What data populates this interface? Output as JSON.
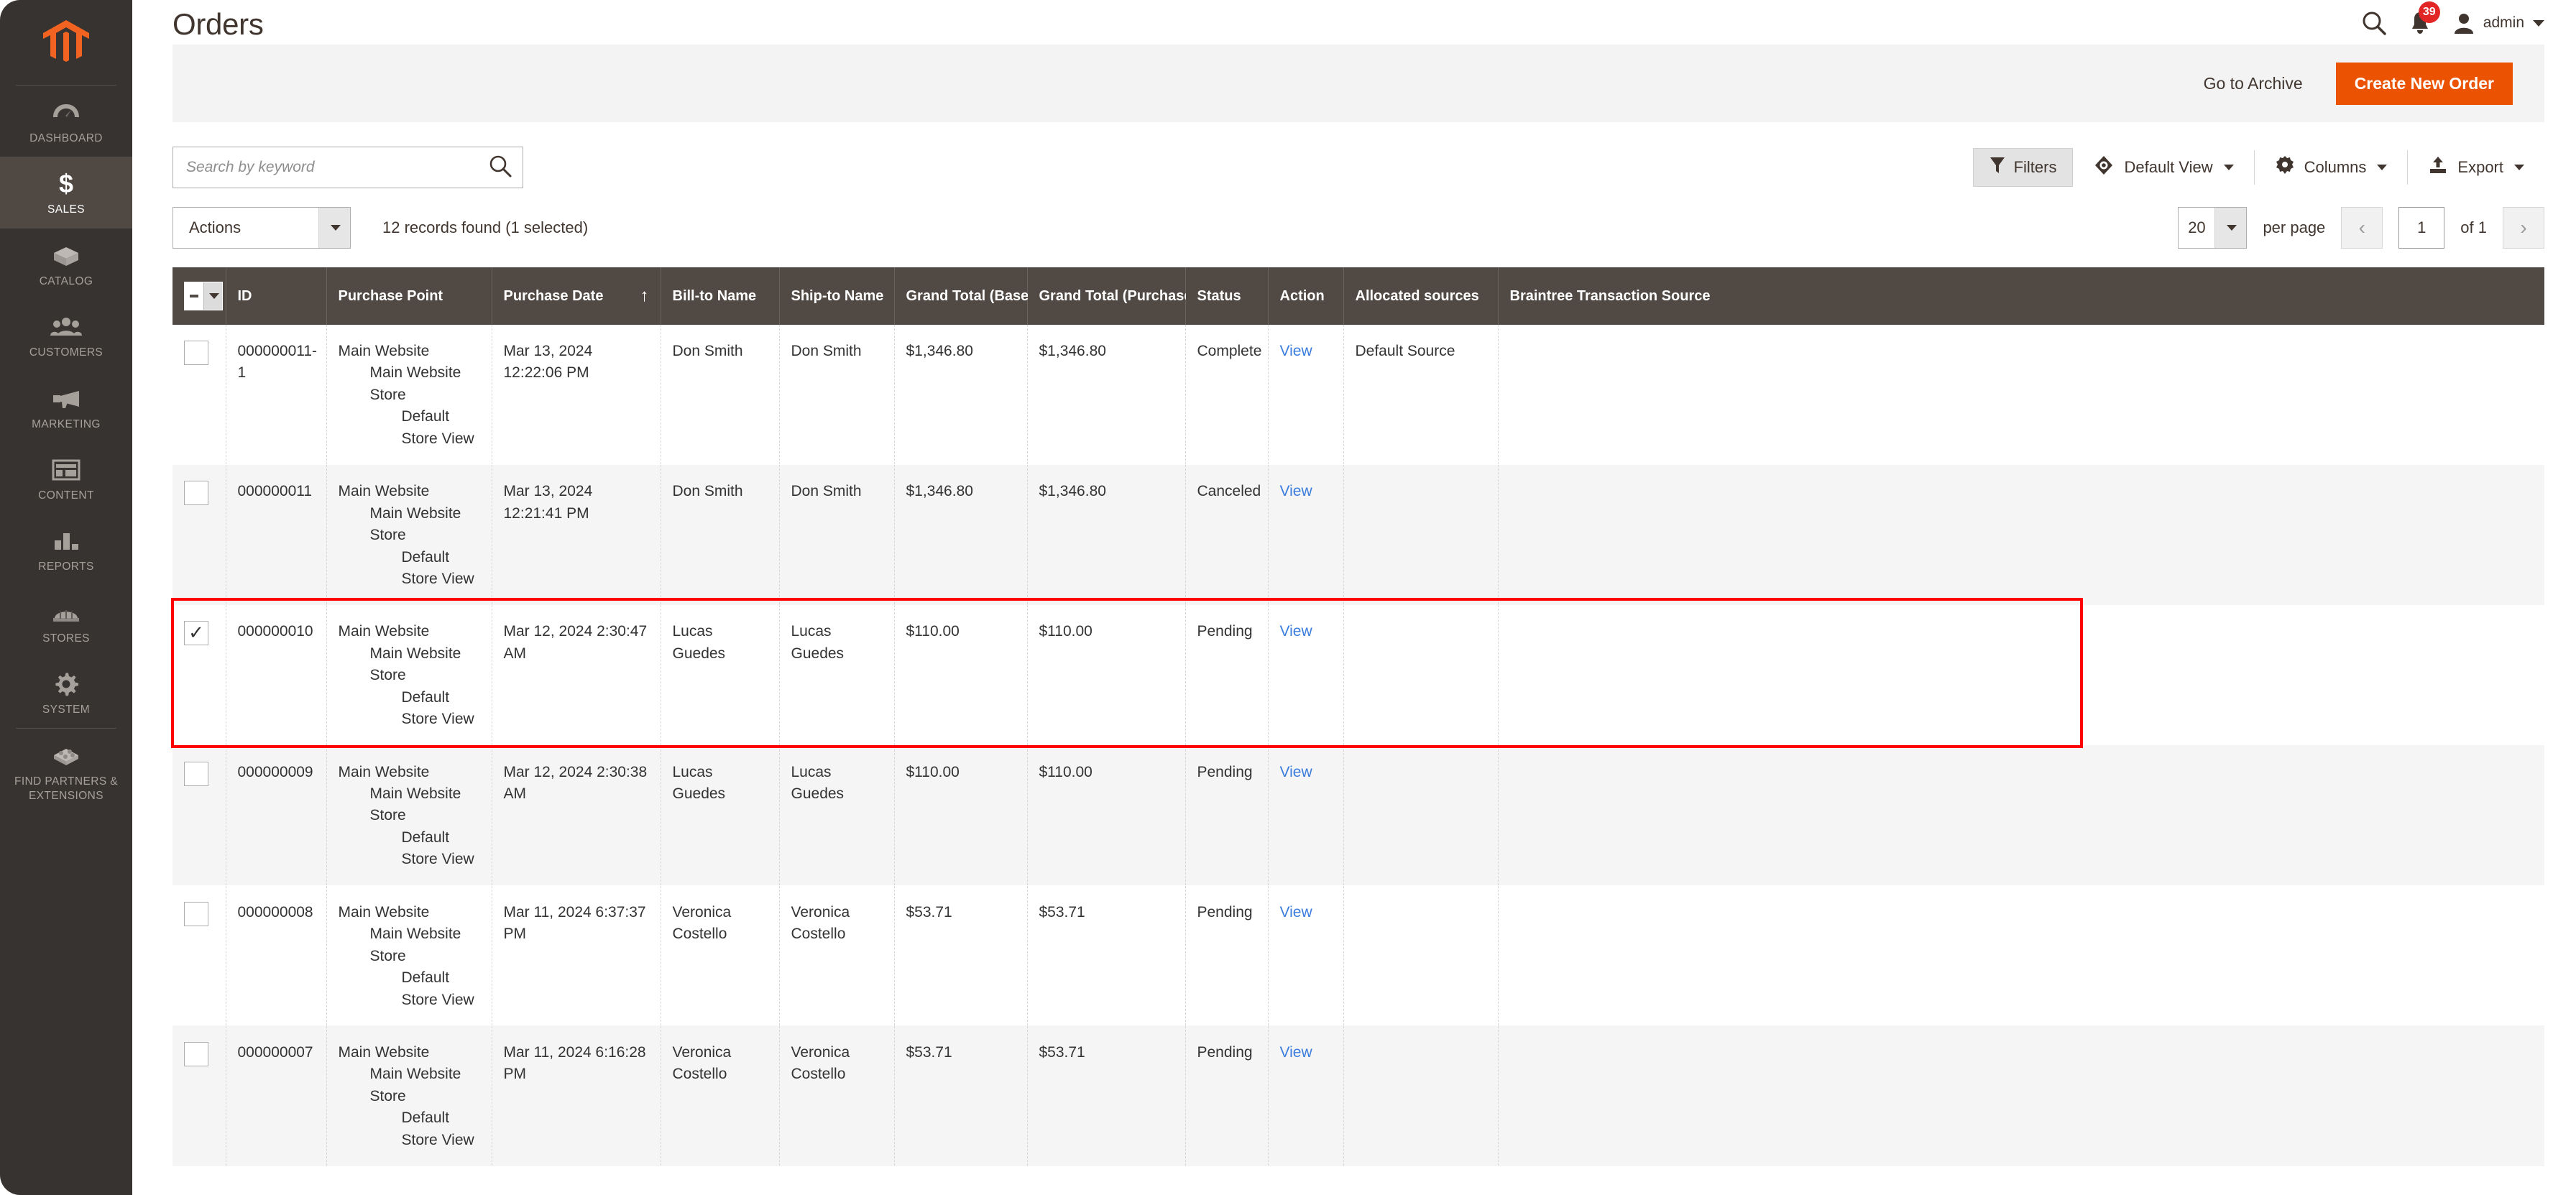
{
  "sidebar": {
    "logo_name": "magento-logo",
    "items": [
      {
        "label": "DASHBOARD",
        "icon": "dashboard-icon",
        "active": false
      },
      {
        "label": "SALES",
        "icon": "sales-dollar-icon",
        "active": true
      },
      {
        "label": "CATALOG",
        "icon": "catalog-box-icon",
        "active": false
      },
      {
        "label": "CUSTOMERS",
        "icon": "customers-icon",
        "active": false
      },
      {
        "label": "MARKETING",
        "icon": "marketing-megaphone-icon",
        "active": false
      },
      {
        "label": "CONTENT",
        "icon": "content-layout-icon",
        "active": false
      },
      {
        "label": "REPORTS",
        "icon": "reports-bars-icon",
        "active": false
      },
      {
        "label": "STORES",
        "icon": "stores-awning-icon",
        "active": false
      },
      {
        "label": "SYSTEM",
        "icon": "system-gear-icon",
        "active": false
      },
      {
        "label": "FIND PARTNERS & EXTENSIONS",
        "icon": "extensions-brick-icon",
        "active": false
      }
    ]
  },
  "header": {
    "title": "Orders",
    "search_icon": "search-icon",
    "notifications_icon": "bell-icon",
    "notifications_count": "39",
    "user_icon": "user-avatar-icon",
    "user_name": "admin",
    "user_caret": "chevron-down-icon"
  },
  "page_actions": {
    "go_to_archive": "Go to Archive",
    "create_new_order": "Create New Order",
    "create_button_color": "#eb5202"
  },
  "toolbar": {
    "search_placeholder": "Search by keyword",
    "search_value": "",
    "search_icon": "search-icon",
    "filters_label": "Filters",
    "filters_icon": "funnel-icon",
    "view_label": "Default View",
    "view_icon": "eye-icon",
    "columns_label": "Columns",
    "columns_icon": "gear-icon",
    "export_label": "Export",
    "export_icon": "upload-icon"
  },
  "grid_controls": {
    "actions_label": "Actions",
    "records_found": "12 records found (1 selected)",
    "per_page_value": "20",
    "per_page_label": "per page",
    "prev_icon": "chevron-left-icon",
    "next_icon": "chevron-right-icon",
    "page_value": "1",
    "of_label": "of 1"
  },
  "grid": {
    "columns": [
      {
        "key": "check",
        "label": ""
      },
      {
        "key": "id",
        "label": "ID"
      },
      {
        "key": "pp",
        "label": "Purchase Point"
      },
      {
        "key": "date",
        "label": "Purchase Date",
        "sorted": "asc",
        "sort_icon": "arrow-up-icon"
      },
      {
        "key": "billto",
        "label": "Bill-to Name"
      },
      {
        "key": "shipto",
        "label": "Ship-to Name"
      },
      {
        "key": "gtbase",
        "label": "Grand Total (Base)"
      },
      {
        "key": "gtpurch",
        "label": "Grand Total (Purchased)"
      },
      {
        "key": "status",
        "label": "Status"
      },
      {
        "key": "action",
        "label": "Action"
      },
      {
        "key": "alloc",
        "label": "Allocated sources"
      },
      {
        "key": "braintree",
        "label": "Braintree Transaction Source"
      }
    ],
    "header_checkbox_state": "indeterminate",
    "rows": [
      {
        "selected": false,
        "id": "000000011-1",
        "purchase_point": [
          "Main Website",
          "Main Website Store",
          "Default Store View"
        ],
        "purchase_date": "Mar 13, 2024 12:22:06 PM",
        "bill_to": "Don Smith",
        "ship_to": "Don Smith",
        "grand_total_base": "$1,346.80",
        "grand_total_purchased": "$1,346.80",
        "status": "Complete",
        "action": "View",
        "allocated_sources": "Default Source",
        "braintree": ""
      },
      {
        "selected": false,
        "id": "000000011",
        "purchase_point": [
          "Main Website",
          "Main Website Store",
          "Default Store View"
        ],
        "purchase_date": "Mar 13, 2024 12:21:41 PM",
        "bill_to": "Don Smith",
        "ship_to": "Don Smith",
        "grand_total_base": "$1,346.80",
        "grand_total_purchased": "$1,346.80",
        "status": "Canceled",
        "action": "View",
        "allocated_sources": "",
        "braintree": ""
      },
      {
        "selected": true,
        "id": "000000010",
        "purchase_point": [
          "Main Website",
          "Main Website Store",
          "Default Store View"
        ],
        "purchase_date": "Mar 12, 2024 2:30:47 AM",
        "bill_to": "Lucas Guedes",
        "ship_to": "Lucas Guedes",
        "grand_total_base": "$110.00",
        "grand_total_purchased": "$110.00",
        "status": "Pending",
        "action": "View",
        "allocated_sources": "",
        "braintree": ""
      },
      {
        "selected": false,
        "id": "000000009",
        "purchase_point": [
          "Main Website",
          "Main Website Store",
          "Default Store View"
        ],
        "purchase_date": "Mar 12, 2024 2:30:38 AM",
        "bill_to": "Lucas Guedes",
        "ship_to": "Lucas Guedes",
        "grand_total_base": "$110.00",
        "grand_total_purchased": "$110.00",
        "status": "Pending",
        "action": "View",
        "allocated_sources": "",
        "braintree": ""
      },
      {
        "selected": false,
        "id": "000000008",
        "purchase_point": [
          "Main Website",
          "Main Website Store",
          "Default Store View"
        ],
        "purchase_date": "Mar 11, 2024 6:37:37 PM",
        "bill_to": "Veronica Costello",
        "ship_to": "Veronica Costello",
        "grand_total_base": "$53.71",
        "grand_total_purchased": "$53.71",
        "status": "Pending",
        "action": "View",
        "allocated_sources": "",
        "braintree": ""
      },
      {
        "selected": false,
        "id": "000000007",
        "purchase_point": [
          "Main Website",
          "Main Website Store",
          "Default Store View"
        ],
        "purchase_date": "Mar 11, 2024 6:16:28 PM",
        "bill_to": "Veronica Costello",
        "ship_to": "Veronica Costello",
        "grand_total_base": "$53.71",
        "grand_total_purchased": "$53.71",
        "status": "Pending",
        "action": "View",
        "allocated_sources": "",
        "braintree": ""
      }
    ]
  },
  "annotation": {
    "highlight_color": "#ff0000",
    "highlight_target_row_id": "000000010"
  }
}
